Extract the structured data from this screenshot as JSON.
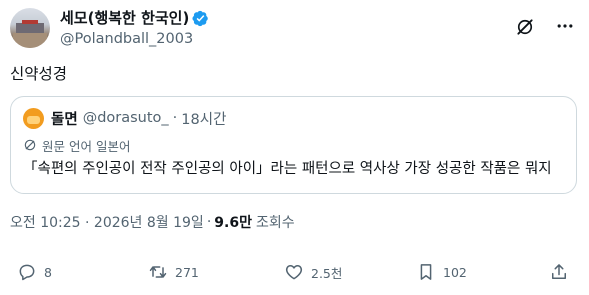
{
  "author": {
    "display_name": "세모(행복한 한국인)",
    "handle": "@Polandball_2003"
  },
  "tweet": {
    "text": "신약성경"
  },
  "quote": {
    "name": "돌면",
    "handle": "@dorasuto_",
    "dot": "·",
    "time": "18시간",
    "translate_label": "원문 언어 일본어",
    "text": "「속편의 주인공이 전작 주인공의 아이」라는 패턴으로 역사상 가장 성공한 작품은 뭐지"
  },
  "meta": {
    "timestamp": "오전 10:25 · 2026년 8월 19일",
    "sep": "·",
    "views": "9.6만",
    "views_label": "조회수"
  },
  "actions": {
    "replies": "8",
    "retweets": "271",
    "likes": "2.5천",
    "bookmarks": "102"
  },
  "colors": {
    "verified": "#1d9bf0",
    "secondary_text": "#536471",
    "border": "#cfd9de",
    "quote_avatar": "#f29c1f"
  }
}
